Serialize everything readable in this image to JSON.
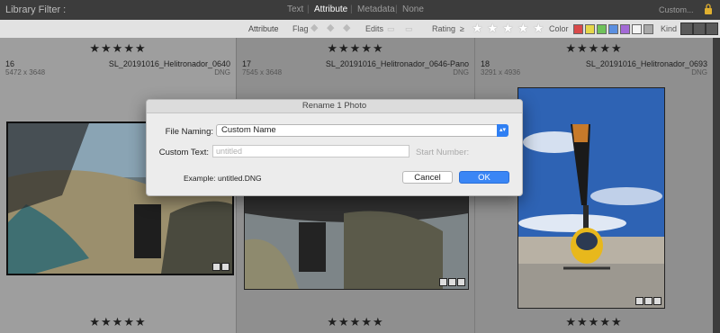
{
  "filterbar": {
    "title": "Library Filter :",
    "tabs": [
      "Text",
      "Attribute",
      "Metadata",
      "None"
    ],
    "active_tab": "Attribute",
    "preset": "Custom..."
  },
  "attrbar": {
    "label": "Attribute",
    "flag": "Flag",
    "edits": "Edits",
    "rating": "Rating",
    "rating_op": "≥",
    "rating_value": 5,
    "color": "Color",
    "color_swatches": [
      "#d94a4a",
      "#e6d74a",
      "#6fc25a",
      "#5a8fe0",
      "#a36ad6",
      "#f4f4f4",
      "#a8a8a8"
    ],
    "kind": "Kind"
  },
  "grid": {
    "cells": [
      {
        "index": "16",
        "filename": "SL_20191016_Helitronador_0640",
        "dimensions": "5472 x 3648",
        "ext": "DNG",
        "rating": "★★★★★"
      },
      {
        "index": "17",
        "filename": "SL_20191016_Helitronador_0646-Pano",
        "dimensions": "7545 x 3648",
        "ext": "DNG",
        "rating": "★★★★★"
      },
      {
        "index": "18",
        "filename": "SL_20191016_Helitronador_0693",
        "dimensions": "3291 x 4936",
        "ext": "DNG",
        "rating": "★★★★★"
      }
    ]
  },
  "dialog": {
    "title": "Rename 1 Photo",
    "file_naming_label": "File Naming:",
    "file_naming_value": "Custom Name",
    "custom_text_label": "Custom Text:",
    "custom_text_placeholder": "untitled",
    "start_number_label": "Start Number:",
    "example_label": "Example:",
    "example_value": "untitled.DNG",
    "cancel_label": "Cancel",
    "ok_label": "OK"
  }
}
